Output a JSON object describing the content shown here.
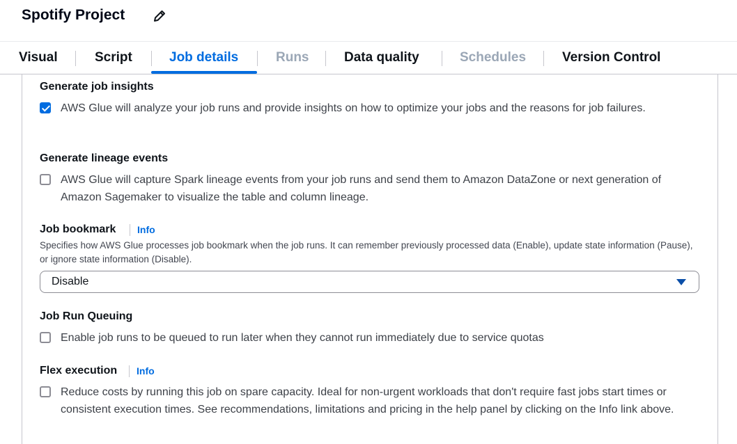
{
  "header": {
    "title": "Spotify Project",
    "edit_icon": "pencil-icon"
  },
  "tabs": [
    {
      "label": "Visual",
      "state": "normal"
    },
    {
      "label": "Script",
      "state": "normal"
    },
    {
      "label": "Job details",
      "state": "active"
    },
    {
      "label": "Runs",
      "state": "disabled"
    },
    {
      "label": "Data quality",
      "state": "normal"
    },
    {
      "label": "Schedules",
      "state": "disabled"
    },
    {
      "label": "Version Control",
      "state": "normal"
    }
  ],
  "job_insights": {
    "label": "Generate job insights",
    "checked": true,
    "text": "AWS Glue will analyze your job runs and provide insights on how to optimize your jobs and the reasons for job failures."
  },
  "lineage_events": {
    "label": "Generate lineage events",
    "checked": false,
    "text": "AWS Glue will capture Spark lineage events from your job runs and send them to Amazon DataZone or next generation of Amazon Sagemaker to visualize the table and column lineage."
  },
  "job_bookmark": {
    "label": "Job bookmark",
    "info": "Info",
    "description": "Specifies how AWS Glue processes job bookmark when the job runs. It can remember previously processed data (Enable), update state information (Pause), or ignore state information (Disable).",
    "selected": "Disable"
  },
  "run_queuing": {
    "label": "Job Run Queuing",
    "checked": false,
    "text": "Enable job runs to be queued to run later when they cannot run immediately due to service quotas"
  },
  "flex_execution": {
    "label": "Flex execution",
    "info": "Info",
    "checked": false,
    "text": "Reduce costs by running this job on spare capacity. Ideal for non-urgent workloads that don't require fast jobs start times or consistent execution times. See recommendations, limitations and pricing in the help panel by clicking on the Info link above."
  },
  "colors": {
    "accent": "#006ce0",
    "disabled": "#9ba7b6",
    "border": "#c6c6cd"
  }
}
